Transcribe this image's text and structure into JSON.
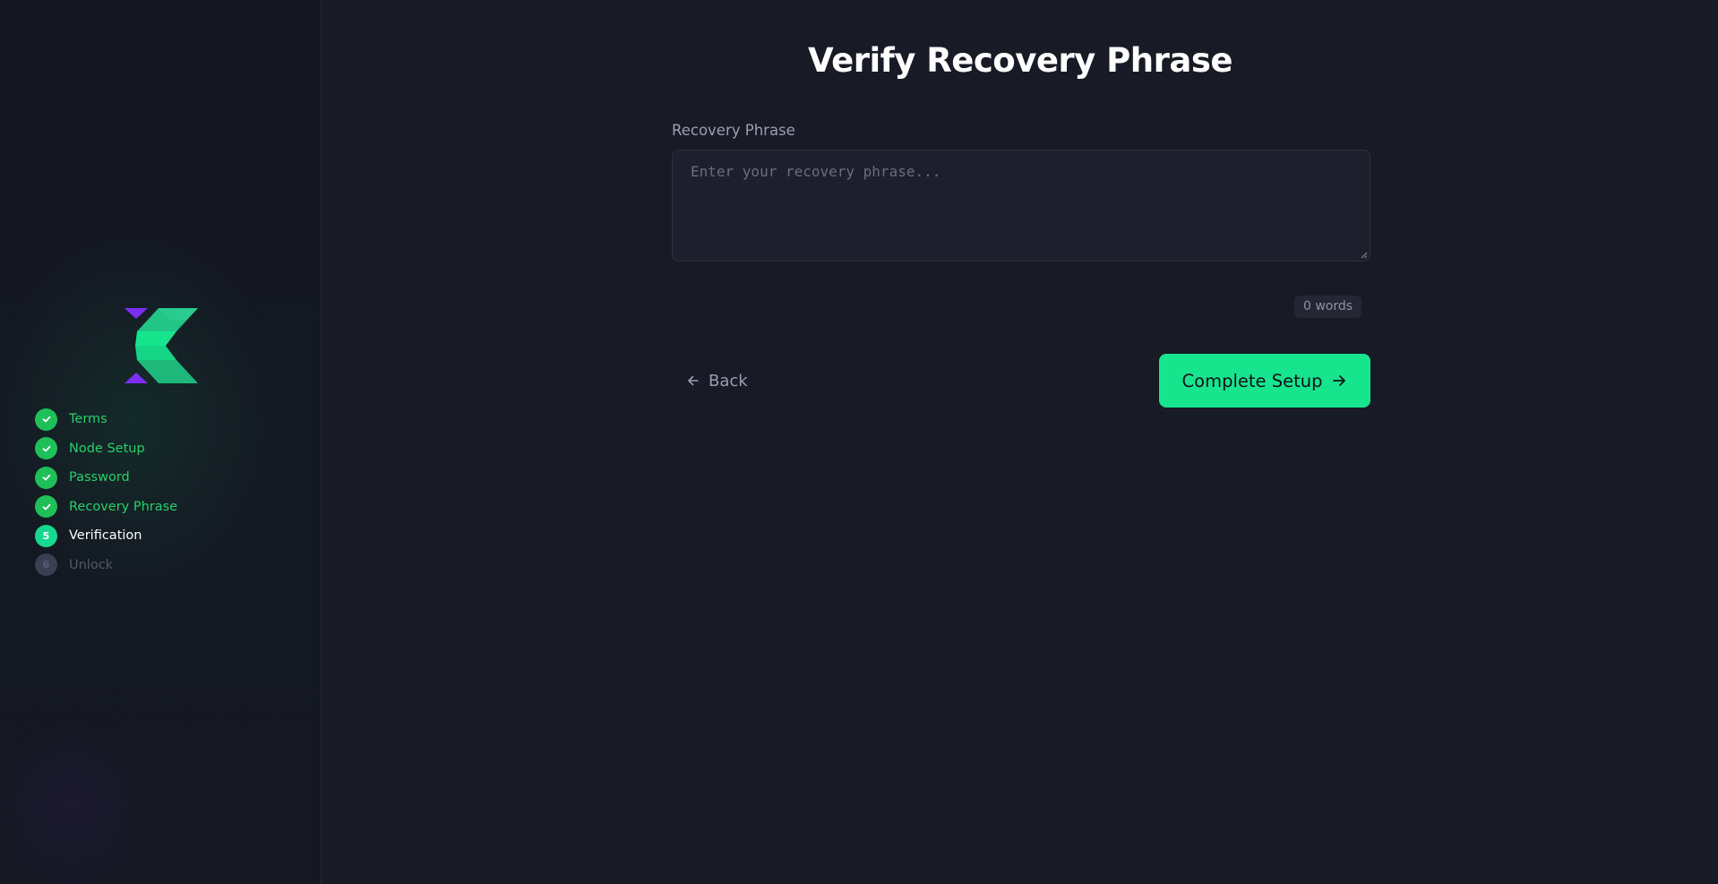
{
  "app": {
    "accent_color": "#17e58e",
    "done_color": "#1fbf5a",
    "logo_primary": "#17d890",
    "logo_secondary": "#7b2ff2"
  },
  "sidebar": {
    "logo": "kaspa-style-k-logo",
    "steps": [
      {
        "number": "1",
        "label": "Terms",
        "state": "done",
        "icon": "check-icon"
      },
      {
        "number": "2",
        "label": "Node Setup",
        "state": "done",
        "icon": "check-icon"
      },
      {
        "number": "3",
        "label": "Password",
        "state": "done",
        "icon": "check-icon"
      },
      {
        "number": "4",
        "label": "Recovery Phrase",
        "state": "done",
        "icon": "check-icon"
      },
      {
        "number": "5",
        "label": "Verification",
        "state": "current"
      },
      {
        "number": "6",
        "label": "Unlock",
        "state": "pending"
      }
    ]
  },
  "main": {
    "title": "Verify Recovery Phrase",
    "field_label": "Recovery Phrase",
    "textarea": {
      "value": "",
      "placeholder": "Enter your recovery phrase..."
    },
    "word_count": "0 words",
    "back_label": "Back",
    "complete_label": "Complete Setup"
  }
}
